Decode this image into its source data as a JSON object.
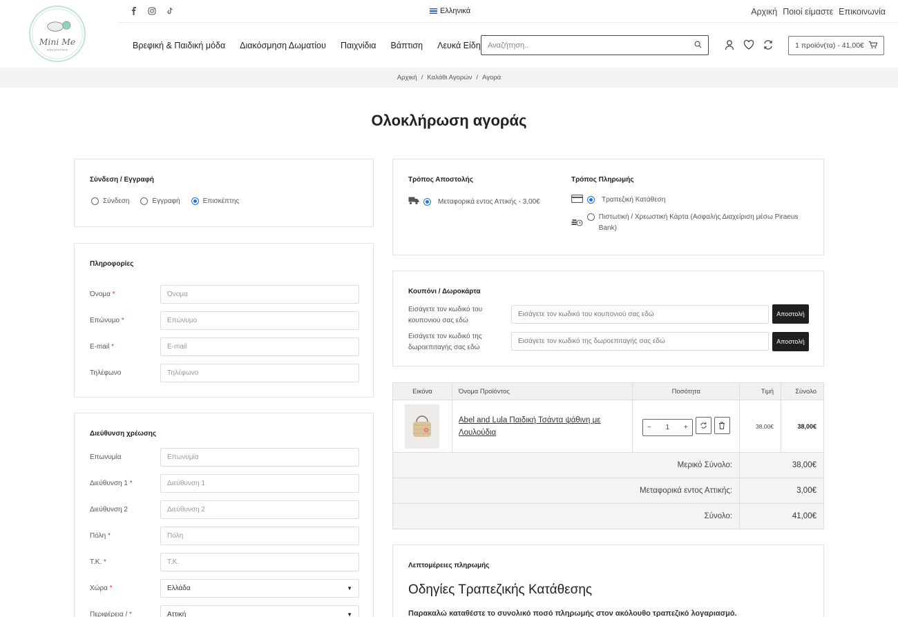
{
  "header": {
    "language": "Ελληνικά",
    "top_links": [
      "Αρχική",
      "Ποιοί είμαστε",
      "Επικοινωνία"
    ],
    "nav": [
      "Βρεφική & Παιδική μόδα",
      "Διακόσμηση Δωματίου",
      "Παιχνίδια",
      "Βάπτιση",
      "Λευκά Είδη"
    ],
    "search_placeholder": "Αναζήτηση..",
    "cart_label": "1 προϊόν(τα) - 41,00€",
    "logo_text": "Mini Me",
    "logo_sub": "KIDS BOUTIQUE"
  },
  "breadcrumb": [
    "Αρχική",
    "Καλάθι Αγορών",
    "Αγορά"
  ],
  "page_title": "Ολοκλήρωση αγοράς",
  "login": {
    "title": "Σύνδεση / Εγγραφή",
    "options": [
      "Σύνδεση",
      "Εγγραφή",
      "Επισκέπτης"
    ],
    "selected": "Επισκέπτης"
  },
  "info": {
    "title": "Πληροφορίες",
    "fields": [
      {
        "label": "Όνομα",
        "required": true,
        "placeholder": "Όνομα"
      },
      {
        "label": "Επώνυμο",
        "required": true,
        "placeholder": "Επώνυμο"
      },
      {
        "label": "E-mail",
        "required": true,
        "placeholder": "E-mail"
      },
      {
        "label": "Τηλέφωνο",
        "required": false,
        "placeholder": "Τηλέφωνο"
      }
    ]
  },
  "billing": {
    "title": "Διεύθυνση χρέωσης",
    "fields": [
      {
        "label": "Επωνυμία",
        "required": false,
        "placeholder": "Επωνυμία"
      },
      {
        "label": "Διεύθυνση 1",
        "required": true,
        "placeholder": "Διεύθυνση 1"
      },
      {
        "label": "Διεύθυνση 2",
        "required": false,
        "placeholder": "Διεύθυνση 2"
      },
      {
        "label": "Πόλη",
        "required": true,
        "placeholder": "Πόλη"
      },
      {
        "label": "Τ.Κ.",
        "required": true,
        "placeholder": "Τ.Κ."
      }
    ],
    "country_label": "Χώρα",
    "country_value": "Ελλάδα",
    "region_label": "Περιφέρεια /",
    "region_value": "Αττική"
  },
  "shipping": {
    "title": "Τρόπος Αποστολής",
    "option": "Μεταφορικά εντος Αττικής - 3,00€"
  },
  "payment": {
    "title": "Τρόπος Πληρωμής",
    "options": [
      "Τραπεζική Κατάθεση",
      "Πιστωτική / Χρεωστική Κάρτα (Ασφαλής Διαχείριση μέσω Piraeus Bank)"
    ],
    "selected": "Τραπεζική Κατάθεση"
  },
  "coupon": {
    "title": "Κουπόνι / Δωροκάρτα",
    "coupon_label": "Εισάγετε τον κωδικό του κουπονιού σας εδώ",
    "coupon_placeholder": "Εισάγετε τον κωδικό του κουπονιού σας εδώ",
    "gift_label": "Εισάγετε τον κωδικό της δωροεπιταγής σας εδώ",
    "gift_placeholder": "Εισάγετε τον κωδικό της δωροεπιταγής σας εδώ",
    "button": "Αποστολή"
  },
  "cart": {
    "headers": [
      "Εικόνα",
      "Όνομα Προϊόντος",
      "Ποσότητα",
      "Τιμή",
      "Σύνολο"
    ],
    "item": {
      "name": "Abel and Lula Παιδική Τσάντα ψάθινη με Λουλούδια",
      "qty": "1",
      "price": "38,00€",
      "total": "38,00€"
    },
    "totals": [
      {
        "label": "Μερικό Σύνολο:",
        "value": "38,00€"
      },
      {
        "label": "Μεταφορικά εντος Αττικής:",
        "value": "3,00€"
      },
      {
        "label": "Σύνολο:",
        "value": "41,00€"
      }
    ]
  },
  "payment_details": {
    "title": "Λεπτομέρειες πληρωμής",
    "heading": "Οδηγίες Τραπεζικής Κατάθεσης",
    "text": "Παρακαλώ καταθέστε το συνολικό ποσό πληρωμής στον ακόλουθο τραπεζικό λογαριασμό."
  }
}
